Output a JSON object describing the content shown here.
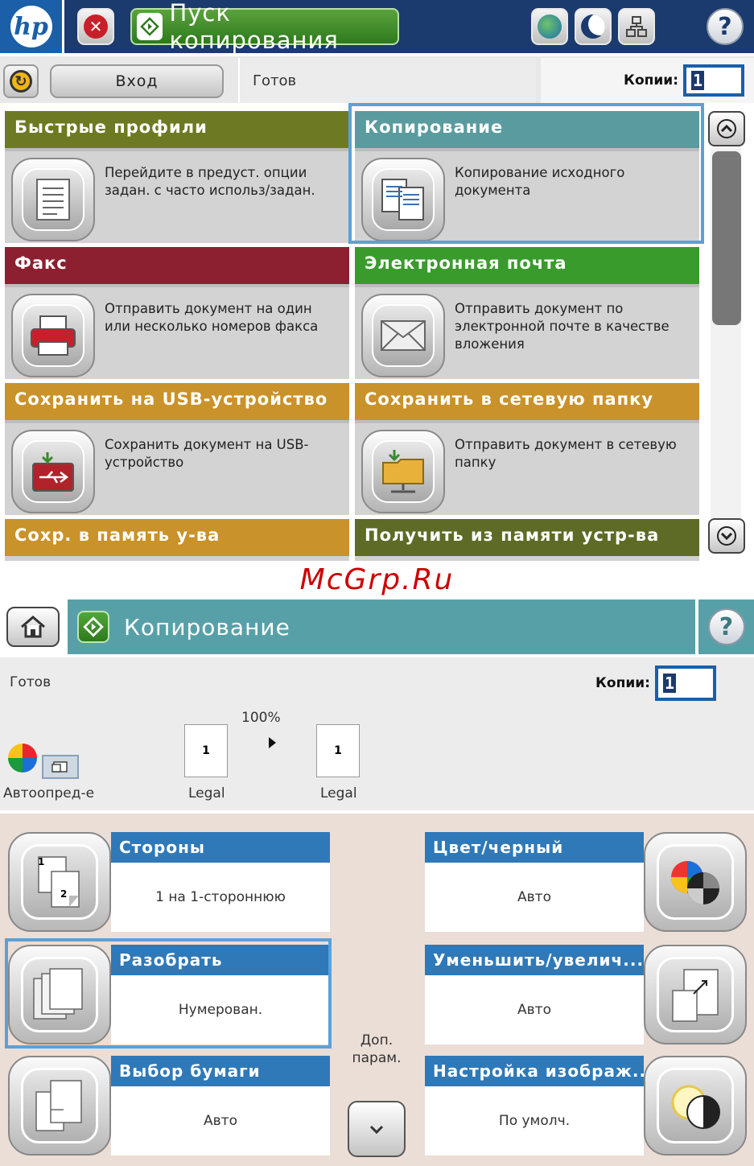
{
  "screen1": {
    "header": {
      "logo": "hp",
      "stop_icon": "stop-icon",
      "start_copy_label": "Пуск копирования",
      "icons": [
        "network-icon",
        "sleep-icon",
        "connection-icon"
      ],
      "help": "?"
    },
    "status_row": {
      "sign_in_label": "Вход",
      "status": "Готов",
      "copies_label": "Копии:",
      "copies_value": "1"
    },
    "tiles": [
      {
        "title": "Быстрые профили",
        "description": "Перейдите в предуст. опции задан. с часто использ/задан.",
        "icon": "quick-sets-icon",
        "color": "#6d7a23",
        "selected": false
      },
      {
        "title": "Копирование",
        "description": "Копирование исходного документа",
        "icon": "copy-icon",
        "color": "#5a9ba0",
        "selected": true
      },
      {
        "title": "Факс",
        "description": "Отправить документ на один или несколько номеров факса",
        "icon": "fax-icon",
        "color": "#8c2030",
        "selected": false
      },
      {
        "title": "Электронная почта",
        "description": "Отправить документ по электронной почте в качестве вложения",
        "icon": "email-icon",
        "color": "#3a9b2d",
        "selected": false
      },
      {
        "title": "Сохранить на USB-устройство",
        "description": "Сохранить документ на USB-устройство",
        "icon": "usb-icon",
        "color": "#c9922a",
        "selected": false
      },
      {
        "title": "Сохранить в сетевую папку",
        "description": "Отправить документ в сетевую папку",
        "icon": "network-folder-icon",
        "color": "#c9922a",
        "selected": false
      },
      {
        "title": "Сохр. в память у-ва",
        "description": "",
        "icon": "",
        "color": "#c9922a",
        "selected": false
      },
      {
        "title": "Получить из памяти устр-ва",
        "description": "",
        "icon": "",
        "color": "#5e6b26",
        "selected": false
      }
    ]
  },
  "watermark": "McGrp.Ru",
  "screen2": {
    "title": "Копирование",
    "help": "?",
    "status": "Готов",
    "copies_label": "Копии:",
    "copies_value": "1",
    "preview": {
      "zoom": "100%",
      "original": {
        "page": "1",
        "size": "Legal"
      },
      "copy": {
        "page": "1",
        "size": "Legal"
      },
      "color_mode": "Автоопред-е"
    },
    "options": [
      {
        "title": "Стороны",
        "value": "1 на 1-стороннюю",
        "icon": "sides-icon",
        "side": "left",
        "selected": false
      },
      {
        "title": "Цвет/черный",
        "value": "Авто",
        "icon": "color-black-icon",
        "side": "right",
        "selected": false
      },
      {
        "title": "Разобрать",
        "value": "Нумерован.",
        "icon": "collate-icon",
        "side": "left",
        "selected": true
      },
      {
        "title": "Уменьшить/увелич...",
        "value": "Авто",
        "icon": "reduce-enlarge-icon",
        "side": "right",
        "selected": false
      },
      {
        "title": "Выбор бумаги",
        "value": "Авто",
        "icon": "paper-select-icon",
        "side": "left",
        "selected": false
      },
      {
        "title": "Настройка изображ...",
        "value": "По умолч.",
        "icon": "image-adjust-icon",
        "side": "right",
        "selected": false
      }
    ],
    "more_options_label": "Доп. парам.",
    "page_labels": {
      "sides_1": "1",
      "sides_2": "2"
    }
  },
  "colors": {
    "header_blue": "#1b3a6e",
    "accent_blue": "#2f79b8",
    "selection_blue": "#5aa1d8",
    "copy_teal": "#58a0a8",
    "go_green": "#3a8a28"
  }
}
